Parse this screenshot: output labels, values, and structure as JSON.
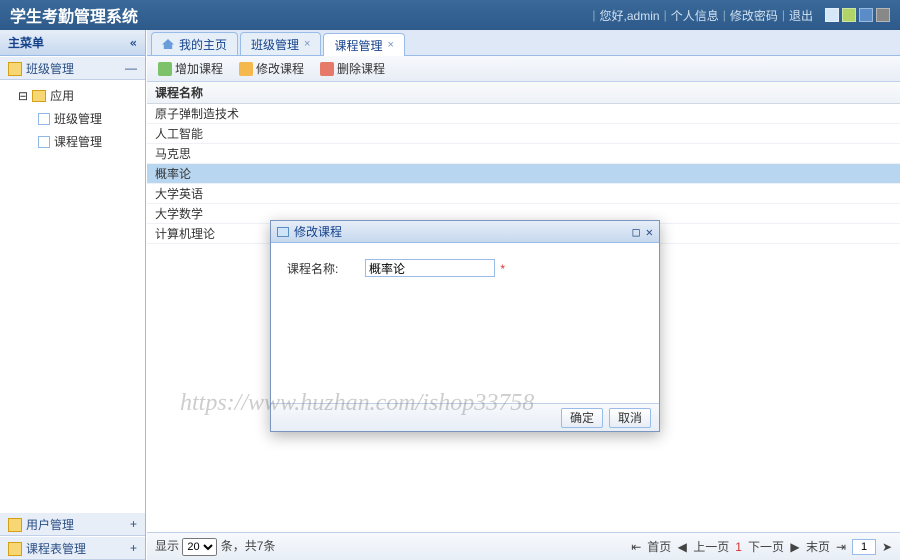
{
  "header": {
    "title": "学生考勤管理系统",
    "greeting": "您好,admin",
    "links": [
      "个人信息",
      "修改密码",
      "退出"
    ]
  },
  "sidebar": {
    "title": "主菜单",
    "sections": [
      {
        "label": "班级管理",
        "tree_root": "应用",
        "children": [
          "班级管理",
          "课程管理"
        ]
      },
      {
        "label": "用户管理"
      },
      {
        "label": "课程表管理"
      }
    ]
  },
  "tabs": [
    {
      "label": "我的主页",
      "home": true,
      "closable": false
    },
    {
      "label": "班级管理",
      "closable": true
    },
    {
      "label": "课程管理",
      "closable": true,
      "active": true
    }
  ],
  "toolbar": {
    "add": "增加课程",
    "edit": "修改课程",
    "del": "删除课程"
  },
  "grid": {
    "header": "课程名称",
    "rows": [
      "原子弹制造技术",
      "人工智能",
      "马克思",
      "概率论",
      "大学英语",
      "大学数学",
      "计算机理论"
    ],
    "selected_index": 3
  },
  "pager": {
    "show_label": "显示",
    "page_size": "20",
    "count_label": "条，共7条",
    "first": "首页",
    "prev": "上一页",
    "next": "下一页",
    "last": "末页",
    "current": "1"
  },
  "dialog": {
    "title": "修改课程",
    "field_label": "课程名称:",
    "field_value": "概率论",
    "ok": "确定",
    "cancel": "取消"
  },
  "watermark": "https://www.huzhan.com/ishop33758"
}
